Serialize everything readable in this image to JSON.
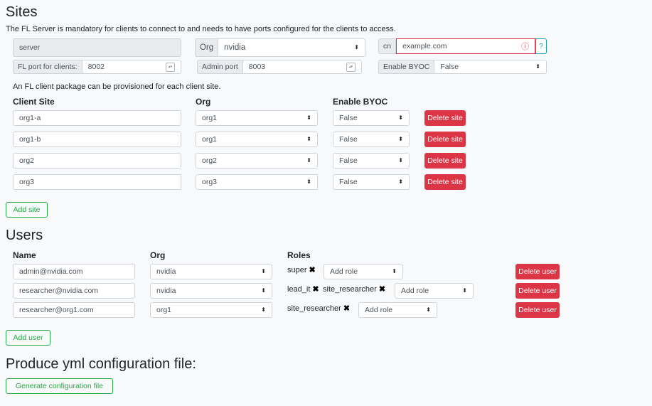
{
  "sites": {
    "heading": "Sites",
    "description": "The FL Server is mandatory for clients to connect to and needs to have ports configured for the clients to access.",
    "server": {
      "name_value": "server",
      "org_label": "Org",
      "org_value": "nvidia",
      "cn_label": "cn",
      "cn_placeholder": "example.com",
      "help_label": "?",
      "fl_port_label": "FL port for clients:",
      "fl_port_value": "8002",
      "admin_port_label": "Admin port",
      "admin_port_value": "8003",
      "byoc_label": "Enable BYOC",
      "byoc_value": "False"
    },
    "client_note": "An FL client package can be provisioned for each client site.",
    "headers": {
      "client_site": "Client Site",
      "org": "Org",
      "byoc": "Enable BYOC"
    },
    "clients": [
      {
        "name": "org1-a",
        "org": "org1",
        "byoc": "False",
        "delete_label": "Delete site"
      },
      {
        "name": "org1-b",
        "org": "org1",
        "byoc": "False",
        "delete_label": "Delete site"
      },
      {
        "name": "org2",
        "org": "org2",
        "byoc": "False",
        "delete_label": "Delete site"
      },
      {
        "name": "org3",
        "org": "org3",
        "byoc": "False",
        "delete_label": "Delete site"
      }
    ],
    "add_site_label": "Add site"
  },
  "users": {
    "heading": "Users",
    "headers": {
      "name": "Name",
      "org": "Org",
      "roles": "Roles"
    },
    "add_role_label": "Add role",
    "rows": [
      {
        "name": "admin@nvidia.com",
        "org": "nvidia",
        "roles": [
          "super"
        ],
        "delete_label": "Delete user"
      },
      {
        "name": "researcher@nvidia.com",
        "org": "nvidia",
        "roles": [
          "lead_it",
          "site_researcher"
        ],
        "delete_label": "Delete user"
      },
      {
        "name": "researcher@org1.com",
        "org": "org1",
        "roles": [
          "site_researcher"
        ],
        "delete_label": "Delete user"
      }
    ],
    "add_user_label": "Add user"
  },
  "produce": {
    "heading": "Produce yml configuration file:",
    "generate_label": "Generate configuration file"
  },
  "icons": {
    "select": "chevron-updown-icon",
    "remove_role": "close-icon",
    "spinner": "spinner-icon",
    "error": "error-circle-icon"
  },
  "colors": {
    "danger": "#dc3545",
    "success": "#28a745",
    "info": "#17a2b8"
  }
}
